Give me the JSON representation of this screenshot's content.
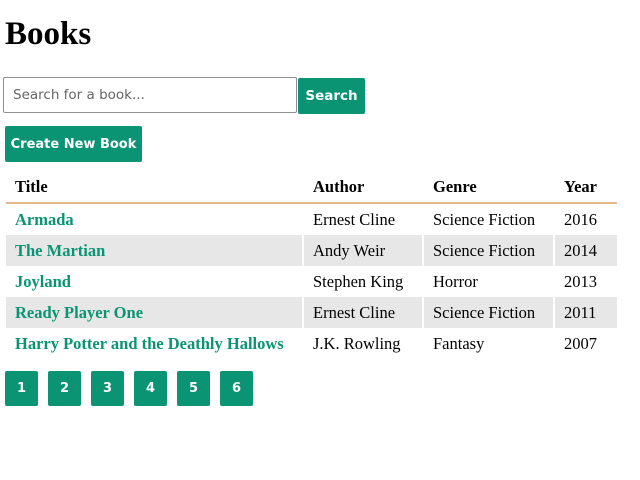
{
  "page": {
    "title": "Books"
  },
  "search": {
    "placeholder": "Search for a book...",
    "value": "",
    "button_label": "Search"
  },
  "actions": {
    "create_label": "Create New Book"
  },
  "table": {
    "headers": [
      "Title",
      "Author",
      "Genre",
      "Year"
    ],
    "rows": [
      {
        "title": "Armada",
        "author": "Ernest Cline",
        "genre": "Science Fiction",
        "year": "2016"
      },
      {
        "title": "The Martian",
        "author": "Andy Weir",
        "genre": "Science Fiction",
        "year": "2014"
      },
      {
        "title": "Joyland",
        "author": "Stephen King",
        "genre": "Horror",
        "year": "2013"
      },
      {
        "title": "Ready Player One",
        "author": "Ernest Cline",
        "genre": "Science Fiction",
        "year": "2011"
      },
      {
        "title": "Harry Potter and the Deathly Hallows",
        "author": "J.K. Rowling",
        "genre": "Fantasy",
        "year": "2007"
      }
    ]
  },
  "pagination": {
    "pages": [
      "1",
      "2",
      "3",
      "4",
      "5",
      "6"
    ]
  },
  "colors": {
    "accent": "#0a9474",
    "header_rule": "#e5b88a",
    "stripe": "#e7e7e7"
  }
}
